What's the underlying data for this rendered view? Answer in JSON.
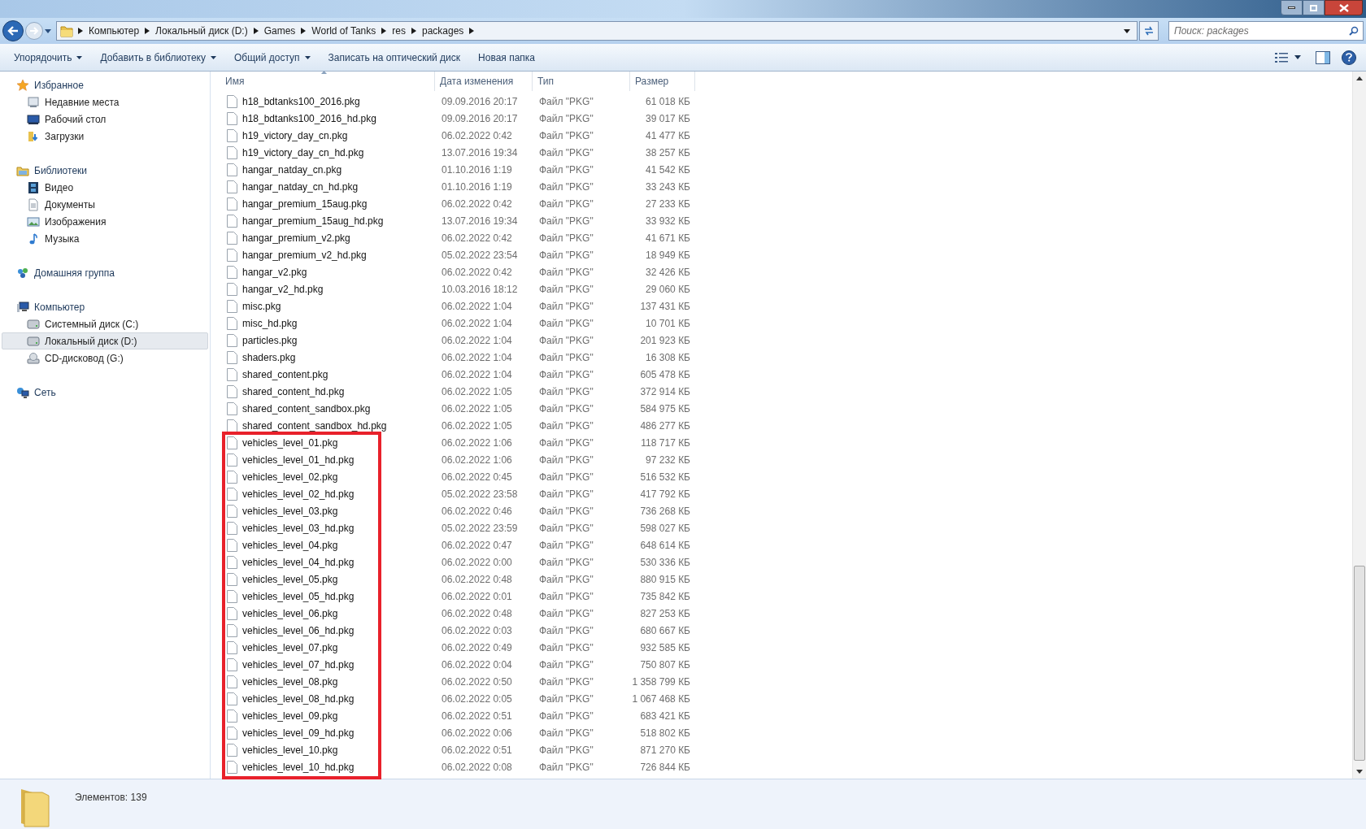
{
  "address_bar": {
    "crumbs": [
      "Компьютер",
      "Локальный диск (D:)",
      "Games",
      "World of Tanks",
      "res",
      "packages"
    ]
  },
  "search": {
    "placeholder": "Поиск: packages"
  },
  "toolbar": {
    "buttons": [
      {
        "label": "Упорядочить",
        "dropdown": true
      },
      {
        "label": "Добавить в библиотеку",
        "dropdown": true
      },
      {
        "label": "Общий доступ",
        "dropdown": true
      },
      {
        "label": "Записать на оптический диск",
        "dropdown": false
      },
      {
        "label": "Новая папка",
        "dropdown": false
      }
    ]
  },
  "sidebar": {
    "groups": [
      {
        "label": "Избранное",
        "children": [
          {
            "label": "Недавние места",
            "selected": false
          },
          {
            "label": "Рабочий стол",
            "selected": false
          },
          {
            "label": "Загрузки",
            "selected": false
          }
        ]
      },
      {
        "label": "Библиотеки",
        "children": [
          {
            "label": "Видео",
            "selected": false
          },
          {
            "label": "Документы",
            "selected": false
          },
          {
            "label": "Изображения",
            "selected": false
          },
          {
            "label": "Музыка",
            "selected": false
          }
        ]
      },
      {
        "label": "Домашняя группа"
      },
      {
        "label": "Компьютер",
        "children": [
          {
            "label": "Системный диск (C:)",
            "selected": false
          },
          {
            "label": "Локальный диск (D:)",
            "selected": true
          },
          {
            "label": "CD-дисковод (G:)",
            "selected": false
          }
        ]
      },
      {
        "label": "Сеть"
      }
    ]
  },
  "table": {
    "columns": [
      "Имя",
      "Дата изменения",
      "Тип",
      "Размер"
    ],
    "row_groups": [
      {
        "highlighted": false,
        "rows": [
          {
            "name": "h18_bdtanks100_2016.pkg",
            "date": "09.09.2016 20:17",
            "type": "Файл \"PKG\"",
            "size": "61 018 КБ"
          },
          {
            "name": "h18_bdtanks100_2016_hd.pkg",
            "date": "09.09.2016 20:17",
            "type": "Файл \"PKG\"",
            "size": "39 017 КБ"
          },
          {
            "name": "h19_victory_day_cn.pkg",
            "date": "06.02.2022 0:42",
            "type": "Файл \"PKG\"",
            "size": "41 477 КБ"
          },
          {
            "name": "h19_victory_day_cn_hd.pkg",
            "date": "13.07.2016 19:34",
            "type": "Файл \"PKG\"",
            "size": "38 257 КБ"
          },
          {
            "name": "hangar_natday_cn.pkg",
            "date": "01.10.2016 1:19",
            "type": "Файл \"PKG\"",
            "size": "41 542 КБ"
          },
          {
            "name": "hangar_natday_cn_hd.pkg",
            "date": "01.10.2016 1:19",
            "type": "Файл \"PKG\"",
            "size": "33 243 КБ"
          },
          {
            "name": "hangar_premium_15aug.pkg",
            "date": "06.02.2022 0:42",
            "type": "Файл \"PKG\"",
            "size": "27 233 КБ"
          },
          {
            "name": "hangar_premium_15aug_hd.pkg",
            "date": "13.07.2016 19:34",
            "type": "Файл \"PKG\"",
            "size": "33 932 КБ"
          },
          {
            "name": "hangar_premium_v2.pkg",
            "date": "06.02.2022 0:42",
            "type": "Файл \"PKG\"",
            "size": "41 671 КБ"
          },
          {
            "name": "hangar_premium_v2_hd.pkg",
            "date": "05.02.2022 23:54",
            "type": "Файл \"PKG\"",
            "size": "18 949 КБ"
          },
          {
            "name": "hangar_v2.pkg",
            "date": "06.02.2022 0:42",
            "type": "Файл \"PKG\"",
            "size": "32 426 КБ"
          },
          {
            "name": "hangar_v2_hd.pkg",
            "date": "10.03.2016 18:12",
            "type": "Файл \"PKG\"",
            "size": "29 060 КБ"
          },
          {
            "name": "misc.pkg",
            "date": "06.02.2022 1:04",
            "type": "Файл \"PKG\"",
            "size": "137 431 КБ"
          },
          {
            "name": "misc_hd.pkg",
            "date": "06.02.2022 1:04",
            "type": "Файл \"PKG\"",
            "size": "10 701 КБ"
          },
          {
            "name": "particles.pkg",
            "date": "06.02.2022 1:04",
            "type": "Файл \"PKG\"",
            "size": "201 923 КБ"
          },
          {
            "name": "shaders.pkg",
            "date": "06.02.2022 1:04",
            "type": "Файл \"PKG\"",
            "size": "16 308 КБ"
          },
          {
            "name": "shared_content.pkg",
            "date": "06.02.2022 1:04",
            "type": "Файл \"PKG\"",
            "size": "605 478 КБ"
          },
          {
            "name": "shared_content_hd.pkg",
            "date": "06.02.2022 1:05",
            "type": "Файл \"PKG\"",
            "size": "372 914 КБ"
          },
          {
            "name": "shared_content_sandbox.pkg",
            "date": "06.02.2022 1:05",
            "type": "Файл \"PKG\"",
            "size": "584 975 КБ"
          },
          {
            "name": "shared_content_sandbox_hd.pkg",
            "date": "06.02.2022 1:05",
            "type": "Файл \"PKG\"",
            "size": "486 277 КБ"
          }
        ]
      },
      {
        "highlighted": true,
        "rows": [
          {
            "name": "vehicles_level_01.pkg",
            "date": "06.02.2022 1:06",
            "type": "Файл \"PKG\"",
            "size": "118 717 КБ"
          },
          {
            "name": "vehicles_level_01_hd.pkg",
            "date": "06.02.2022 1:06",
            "type": "Файл \"PKG\"",
            "size": "97 232 КБ"
          },
          {
            "name": "vehicles_level_02.pkg",
            "date": "06.02.2022 0:45",
            "type": "Файл \"PKG\"",
            "size": "516 532 КБ"
          },
          {
            "name": "vehicles_level_02_hd.pkg",
            "date": "05.02.2022 23:58",
            "type": "Файл \"PKG\"",
            "size": "417 792 КБ"
          },
          {
            "name": "vehicles_level_03.pkg",
            "date": "06.02.2022 0:46",
            "type": "Файл \"PKG\"",
            "size": "736 268 КБ"
          },
          {
            "name": "vehicles_level_03_hd.pkg",
            "date": "05.02.2022 23:59",
            "type": "Файл \"PKG\"",
            "size": "598 027 КБ"
          },
          {
            "name": "vehicles_level_04.pkg",
            "date": "06.02.2022 0:47",
            "type": "Файл \"PKG\"",
            "size": "648 614 КБ"
          },
          {
            "name": "vehicles_level_04_hd.pkg",
            "date": "06.02.2022 0:00",
            "type": "Файл \"PKG\"",
            "size": "530 336 КБ"
          },
          {
            "name": "vehicles_level_05.pkg",
            "date": "06.02.2022 0:48",
            "type": "Файл \"PKG\"",
            "size": "880 915 КБ"
          },
          {
            "name": "vehicles_level_05_hd.pkg",
            "date": "06.02.2022 0:01",
            "type": "Файл \"PKG\"",
            "size": "735 842 КБ"
          },
          {
            "name": "vehicles_level_06.pkg",
            "date": "06.02.2022 0:48",
            "type": "Файл \"PKG\"",
            "size": "827 253 КБ"
          },
          {
            "name": "vehicles_level_06_hd.pkg",
            "date": "06.02.2022 0:03",
            "type": "Файл \"PKG\"",
            "size": "680 667 КБ"
          },
          {
            "name": "vehicles_level_07.pkg",
            "date": "06.02.2022 0:49",
            "type": "Файл \"PKG\"",
            "size": "932 585 КБ"
          },
          {
            "name": "vehicles_level_07_hd.pkg",
            "date": "06.02.2022 0:04",
            "type": "Файл \"PKG\"",
            "size": "750 807 КБ"
          },
          {
            "name": "vehicles_level_08.pkg",
            "date": "06.02.2022 0:50",
            "type": "Файл \"PKG\"",
            "size": "1 358 799 КБ"
          },
          {
            "name": "vehicles_level_08_hd.pkg",
            "date": "06.02.2022 0:05",
            "type": "Файл \"PKG\"",
            "size": "1 067 468 КБ"
          },
          {
            "name": "vehicles_level_09.pkg",
            "date": "06.02.2022 0:51",
            "type": "Файл \"PKG\"",
            "size": "683 421 КБ"
          },
          {
            "name": "vehicles_level_09_hd.pkg",
            "date": "06.02.2022 0:06",
            "type": "Файл \"PKG\"",
            "size": "518 802 КБ"
          },
          {
            "name": "vehicles_level_10.pkg",
            "date": "06.02.2022 0:51",
            "type": "Файл \"PKG\"",
            "size": "871 270 КБ"
          },
          {
            "name": "vehicles_level_10_hd.pkg",
            "date": "06.02.2022 0:08",
            "type": "Файл \"PKG\"",
            "size": "726 844 КБ"
          }
        ]
      }
    ]
  },
  "status_bar": {
    "text": "Элементов: 139"
  }
}
